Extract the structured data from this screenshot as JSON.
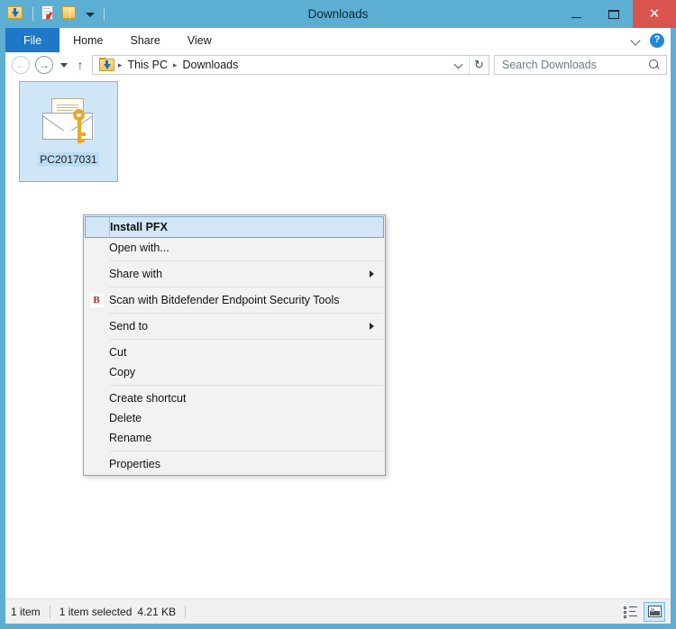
{
  "window": {
    "title": "Downloads",
    "quick_access": [
      {
        "name": "downloads-folder-icon",
        "label": "Downloads"
      },
      {
        "name": "properties-icon",
        "label": "Properties"
      },
      {
        "name": "new-folder-icon",
        "label": "New folder"
      },
      {
        "name": "customize-quick-access-dropdown",
        "label": "Customize Quick Access Toolbar"
      }
    ],
    "controls": {
      "minimize": "–",
      "maximize": "❐",
      "close": "✕"
    }
  },
  "ribbon": {
    "tabs": [
      {
        "label": "File",
        "active": true
      },
      {
        "label": "Home",
        "active": false
      },
      {
        "label": "Share",
        "active": false
      },
      {
        "label": "View",
        "active": false
      }
    ],
    "expand_icon": "chevron-down-icon",
    "help_label": "?"
  },
  "navigation": {
    "back_label": "←",
    "forward_label": "→",
    "recent_label": "recent-locations-dropdown",
    "up_label": "↑",
    "breadcrumbs": [
      "This PC",
      "Downloads"
    ],
    "separator": "▸",
    "refresh_label": "↻"
  },
  "search": {
    "placeholder": "Search Downloads",
    "value": ""
  },
  "files": [
    {
      "name": "PC2017031",
      "icon": "pfx-certificate-icon",
      "selected": true
    }
  ],
  "context_menu": {
    "items": [
      {
        "label": "Install PFX",
        "selected": true,
        "bold": true,
        "submenu": false,
        "icon": null,
        "separator_after": false
      },
      {
        "label": "Open with...",
        "selected": false,
        "bold": false,
        "submenu": false,
        "icon": null,
        "separator_after": true
      },
      {
        "label": "Share with",
        "selected": false,
        "bold": false,
        "submenu": true,
        "icon": null,
        "separator_after": true
      },
      {
        "label": "Scan with Bitdefender Endpoint Security Tools",
        "selected": false,
        "bold": false,
        "submenu": false,
        "icon": "bitdefender-icon",
        "icon_text": "B",
        "separator_after": true
      },
      {
        "label": "Send to",
        "selected": false,
        "bold": false,
        "submenu": true,
        "icon": null,
        "separator_after": true
      },
      {
        "label": "Cut",
        "selected": false,
        "bold": false,
        "submenu": false,
        "icon": null,
        "separator_after": false
      },
      {
        "label": "Copy",
        "selected": false,
        "bold": false,
        "submenu": false,
        "icon": null,
        "separator_after": true
      },
      {
        "label": "Create shortcut",
        "selected": false,
        "bold": false,
        "submenu": false,
        "icon": null,
        "separator_after": false
      },
      {
        "label": "Delete",
        "selected": false,
        "bold": false,
        "submenu": false,
        "icon": null,
        "separator_after": false
      },
      {
        "label": "Rename",
        "selected": false,
        "bold": false,
        "submenu": false,
        "icon": null,
        "separator_after": true
      },
      {
        "label": "Properties",
        "selected": false,
        "bold": false,
        "submenu": false,
        "icon": null,
        "separator_after": false
      }
    ]
  },
  "status_bar": {
    "item_count": "1 item",
    "selection": "1 item selected",
    "size": "4.21 KB",
    "views": [
      {
        "name": "details-view-button",
        "label": "Details view",
        "active": false
      },
      {
        "name": "large-icons-view-button",
        "label": "Large icons view",
        "active": true
      }
    ]
  },
  "colors": {
    "frame": "#5CAED2",
    "accent_tab": "#1E78C8",
    "close_button": "#d9534f",
    "selection": "#cfe6f7",
    "bitdefender_red": "#c0201c"
  }
}
